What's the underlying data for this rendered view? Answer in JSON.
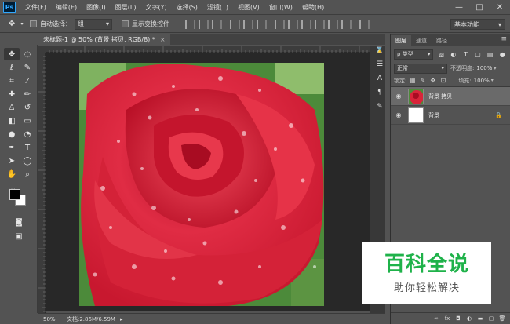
{
  "app": {
    "logo": "Ps"
  },
  "menubar": {
    "items": [
      "文件(F)",
      "编辑(E)",
      "图像(I)",
      "图层(L)",
      "文字(Y)",
      "选择(S)",
      "滤镜(T)",
      "视图(V)",
      "窗口(W)",
      "帮助(H)"
    ]
  },
  "window_controls": {
    "minimize": "—",
    "maximize": "□",
    "close": "✕"
  },
  "options": {
    "auto_select_label": "自动选择：",
    "auto_select_value": "组",
    "show_transform_label": "显示变换控件",
    "workspace": "基本功能"
  },
  "document": {
    "tab_title": "未标题-1 @ 50% (背景 拷贝, RGB/8) *",
    "close_glyph": "×"
  },
  "status": {
    "zoom": "50%",
    "doc_size": "文档:2.86M/6.59M"
  },
  "layers_panel": {
    "tabs": [
      "图层",
      "通道",
      "路径"
    ],
    "menu_glyph": "≡",
    "filter_kind": "ρ 类型",
    "blend_mode": "正常",
    "opacity_label": "不透明度:",
    "opacity_value": "100%",
    "lock_label": "锁定:",
    "fill_label": "填充:",
    "fill_value": "100%",
    "layers": [
      {
        "name": "背景 拷贝",
        "selected": true
      },
      {
        "name": "背景",
        "selected": false
      }
    ],
    "footer_icons": [
      "link-icon",
      "fx-icon",
      "mask-icon",
      "adjustment-icon",
      "folder-icon",
      "new-layer-icon",
      "trash-icon"
    ],
    "footer_labels": [
      "∞",
      "fx",
      "◘",
      "◐",
      "▬",
      "▢",
      "🗑"
    ]
  },
  "watermark": {
    "main": "百科全说",
    "sub": "助你轻松解决"
  },
  "colors": {
    "foreground": "#000000",
    "background": "#ffffff",
    "rose": "#d8243a",
    "accent": "#1fb24a"
  }
}
